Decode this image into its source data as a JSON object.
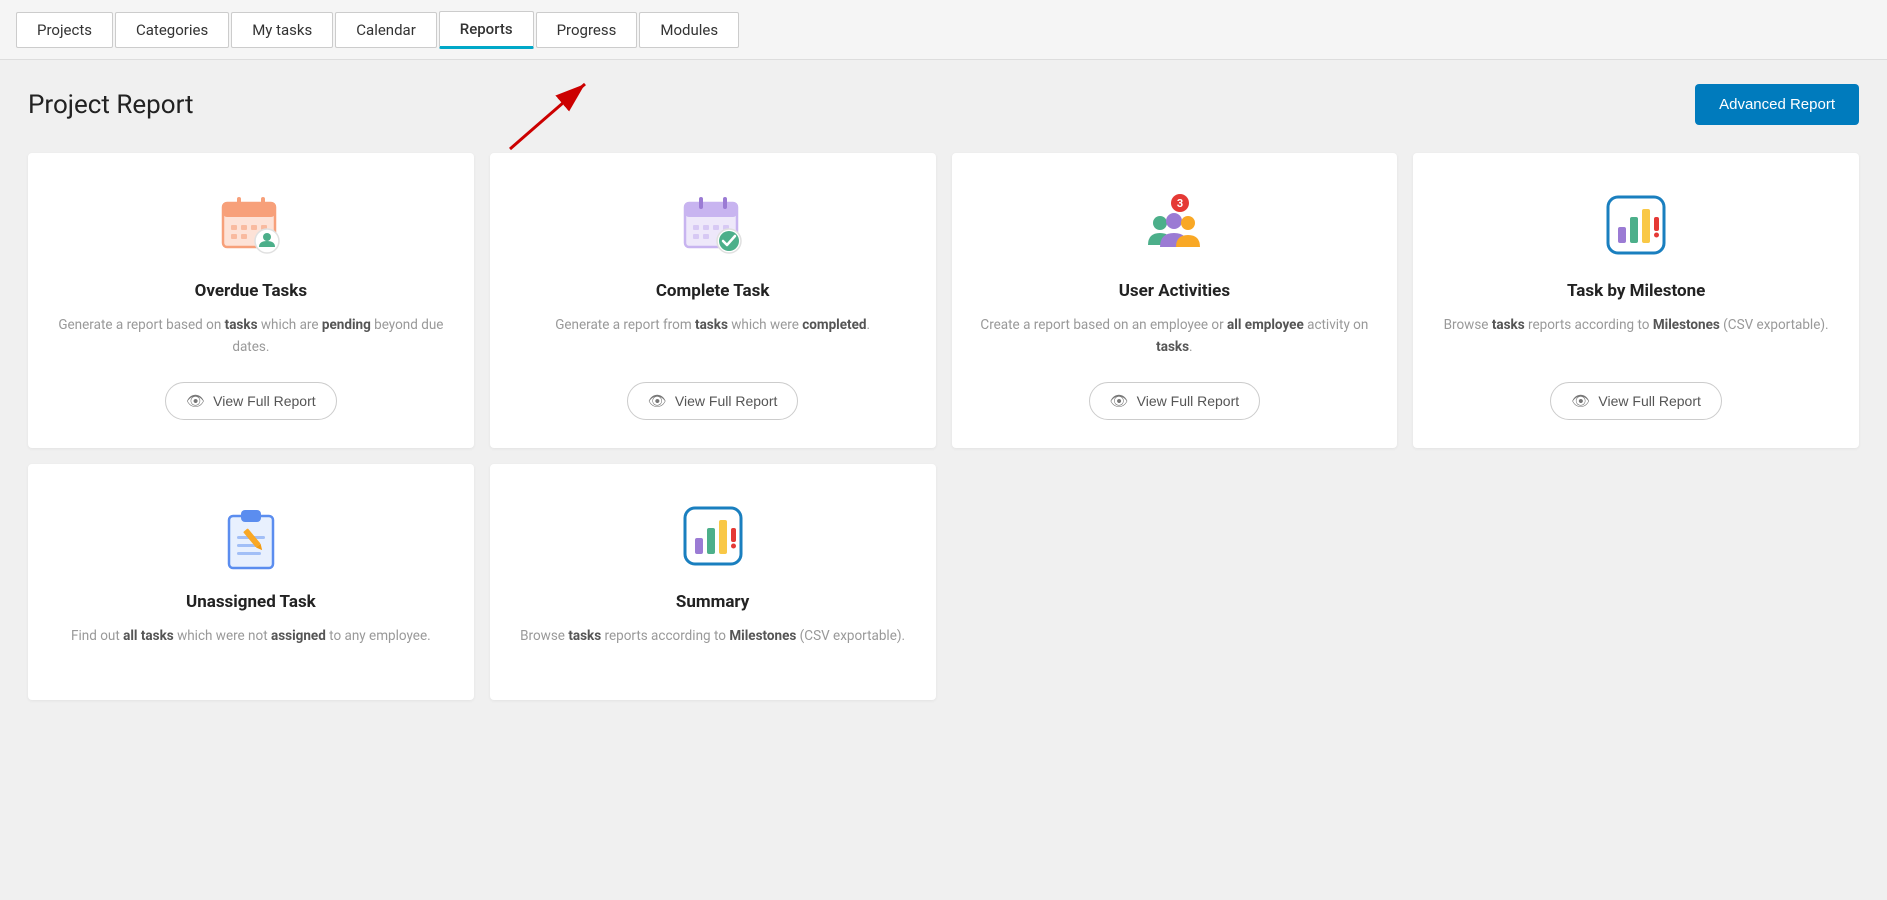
{
  "nav": {
    "tabs": [
      {
        "label": "Projects",
        "active": false
      },
      {
        "label": "Categories",
        "active": false
      },
      {
        "label": "My tasks",
        "active": false
      },
      {
        "label": "Calendar",
        "active": false
      },
      {
        "label": "Reports",
        "active": true
      },
      {
        "label": "Progress",
        "active": false
      },
      {
        "label": "Modules",
        "active": false
      }
    ]
  },
  "header": {
    "title": "Project Report",
    "advanced_report_label": "Advanced Report"
  },
  "cards": [
    {
      "id": "overdue-tasks",
      "title": "Overdue Tasks",
      "desc_plain": "Generate a report based on ",
      "desc_bold1": "tasks",
      "desc_mid": " which are ",
      "desc_bold2": "pending",
      "desc_end": " beyond due dates.",
      "button_label": "View Full Report"
    },
    {
      "id": "complete-task",
      "title": "Complete Task",
      "desc_plain": "Generate a report from ",
      "desc_bold1": "tasks",
      "desc_mid": " which were ",
      "desc_bold2": "completed",
      "desc_end": ".",
      "button_label": "View Full Report"
    },
    {
      "id": "user-activities",
      "title": "User Activities",
      "desc_plain": "Create a report based on an employee or ",
      "desc_bold1": "all employee",
      "desc_mid": " activity on ",
      "desc_bold2": "tasks",
      "desc_end": ".",
      "button_label": "View Full Report"
    },
    {
      "id": "task-by-milestone",
      "title": "Task by Milestone",
      "desc_plain": "Browse ",
      "desc_bold1": "tasks",
      "desc_mid": " reports according to ",
      "desc_bold2": "Milestones",
      "desc_end": " (CSV exportable).",
      "button_label": "View Full Report"
    },
    {
      "id": "unassigned-task",
      "title": "Unassigned Task",
      "desc_plain": "Find out ",
      "desc_bold1": "all tasks",
      "desc_mid": " which were not ",
      "desc_bold2": "assigned",
      "desc_end": " to any employee.",
      "button_label": ""
    },
    {
      "id": "summary",
      "title": "Summary",
      "desc_plain": "Browse ",
      "desc_bold1": "tasks",
      "desc_mid": " reports according to ",
      "desc_bold2": "Milestones",
      "desc_end": " (CSV exportable).",
      "button_label": ""
    }
  ]
}
